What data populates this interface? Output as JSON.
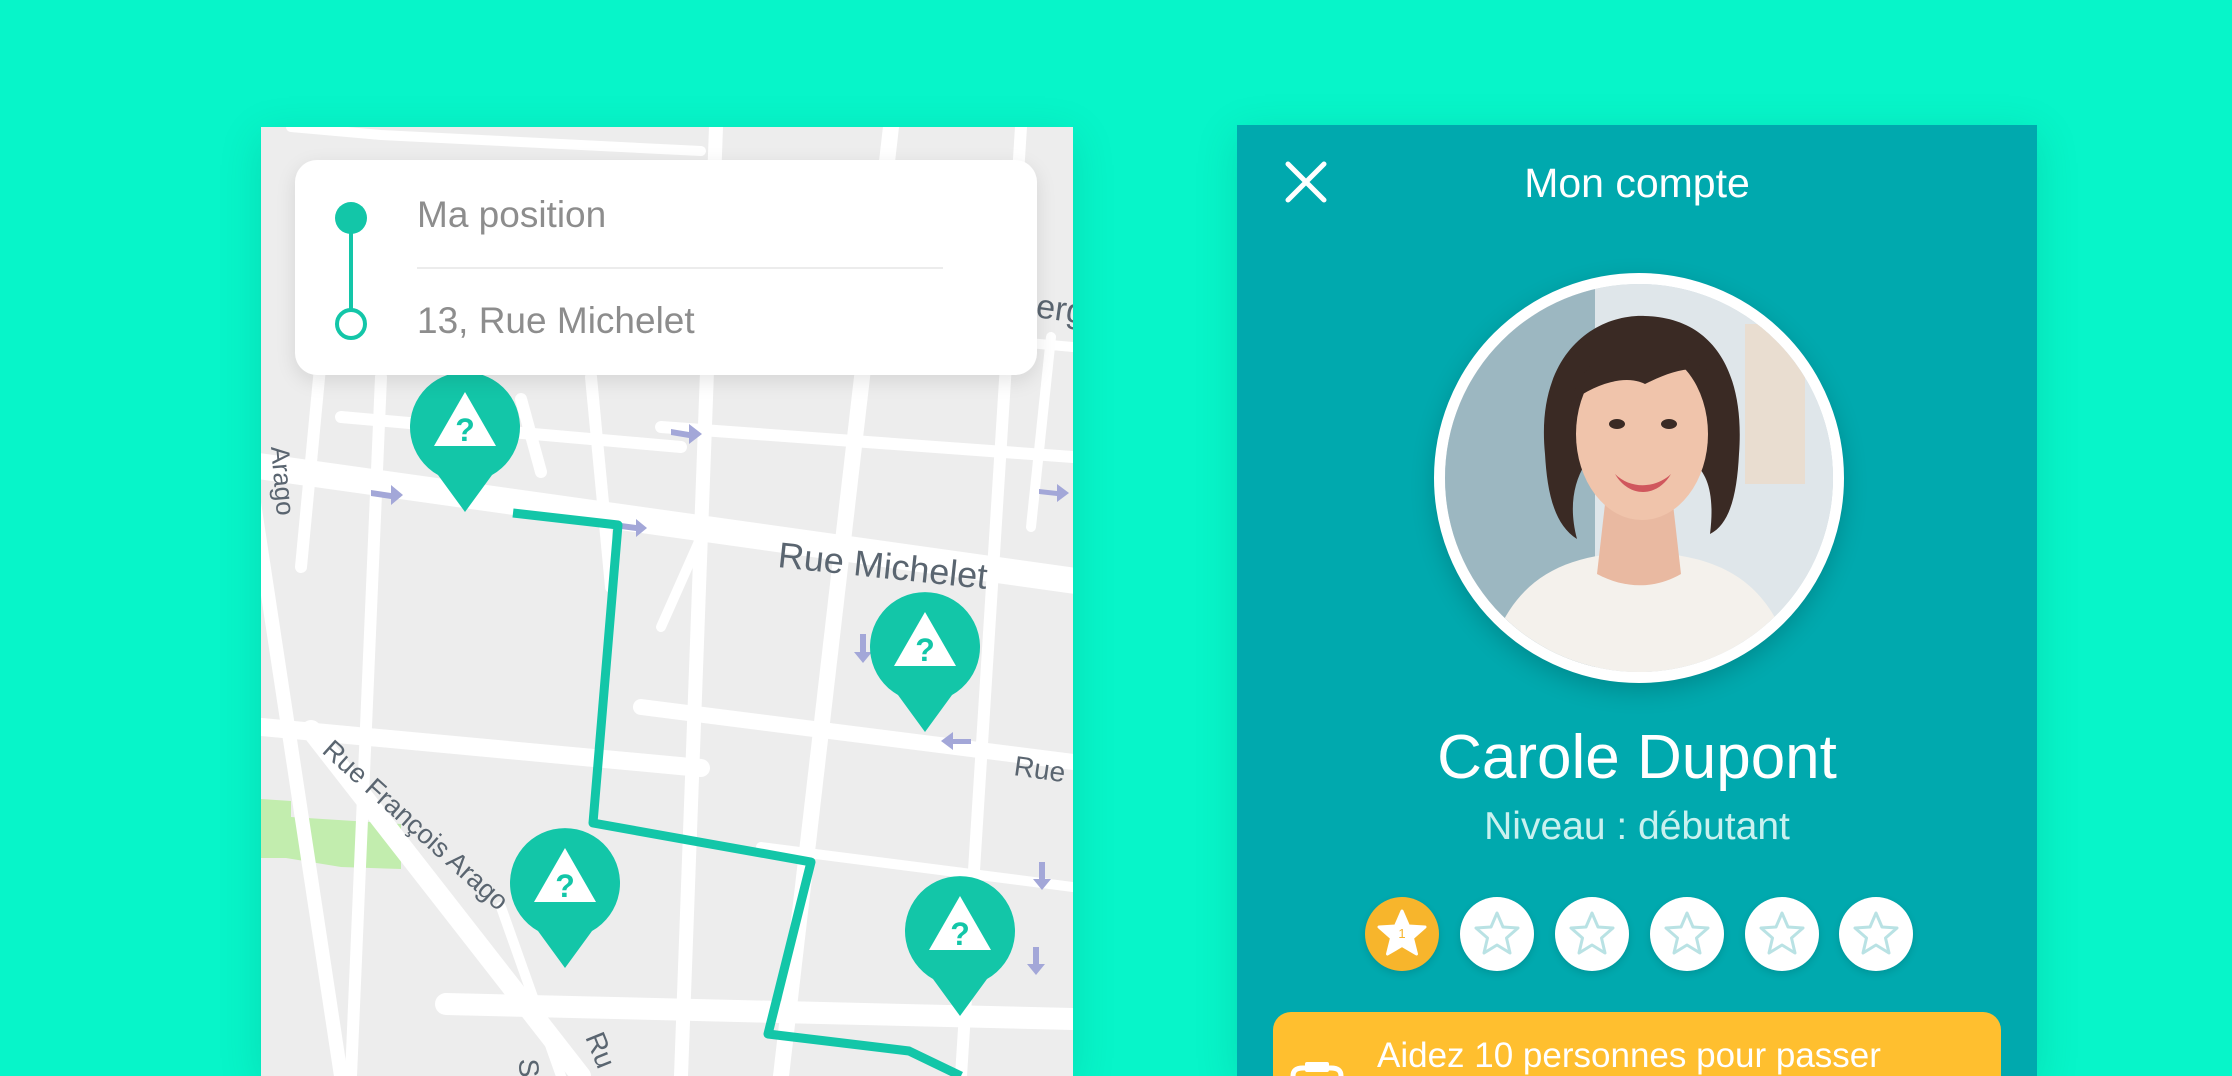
{
  "colors": {
    "background": "#07f5c9",
    "accent": "#13c6a8",
    "account_panel": "#00a9ae",
    "star_active": "#f7b52c",
    "banner": "#ffbf2f"
  },
  "map": {
    "route": {
      "origin": "Ma position",
      "destination": "13, Rue Michelet"
    },
    "streets": {
      "michelet": "Rue Michelet",
      "francois_arago": "Rue François Arago",
      "arago": "Arago",
      "rue_right": "Rue",
      "rue_top_right": "erg",
      "ru_bottom": "Ru",
      "s_bottom": "S"
    },
    "markers": [
      {
        "icon": "warning-question-icon"
      },
      {
        "icon": "warning-question-icon"
      },
      {
        "icon": "warning-question-icon"
      },
      {
        "icon": "warning-question-icon"
      }
    ]
  },
  "account": {
    "title": "Mon compte",
    "close_icon": "close-icon",
    "name": "Carole Dupont",
    "level": "Niveau : débutant",
    "stars": [
      {
        "label": "1",
        "active": true
      },
      {
        "active": false
      },
      {
        "active": false
      },
      {
        "active": false
      },
      {
        "active": false
      },
      {
        "active": false
      }
    ],
    "banner": {
      "icon": "trophy-icon",
      "text": "Aidez 10 personnes pour passer"
    }
  }
}
